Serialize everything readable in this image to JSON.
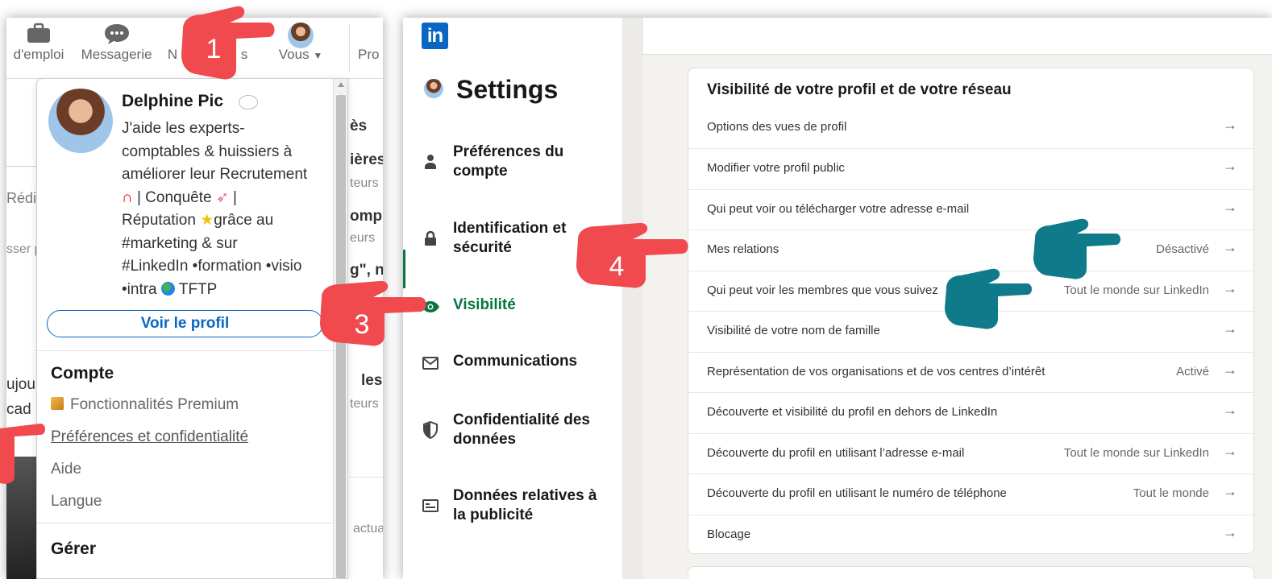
{
  "left_panel": {
    "nav": [
      {
        "label": "d'emploi",
        "icon": "briefcase-icon"
      },
      {
        "label": "Messagerie",
        "icon": "message-icon"
      },
      {
        "label": "N",
        "icon": "bell-icon"
      },
      {
        "label": "s",
        "icon": ""
      },
      {
        "label": "Vous",
        "icon": "avatar-icon"
      },
      {
        "label": "Pro",
        "icon": ""
      }
    ],
    "bg_fragments": [
      "ès",
      "ières",
      "teurs",
      "ompl",
      "eurs",
      "g\", no",
      "les p",
      "teurs",
      "actua",
      "Rédig",
      "sser p",
      "ujou",
      "cad"
    ],
    "dropdown": {
      "name": "Delphine Pic",
      "headline_lines": [
        "J'aide les experts-",
        "comptables & huissiers à",
        "améliorer leur Recrutement",
        "| Conquête",
        "|",
        "Réputation",
        "grâce au",
        "#marketing & sur",
        "#LinkedIn •formation •visio",
        "•intra",
        "TFTP"
      ],
      "view_profile": "Voir le profil",
      "account_title": "Compte",
      "account_items": [
        "Fonctionnalités Premium",
        "Préférences et confidentialité",
        "Aide",
        "Langue"
      ],
      "manage_title": "Gérer"
    }
  },
  "right_panel": {
    "logo": "in",
    "settings_title": "Settings",
    "sidebar": [
      {
        "label": "Préférences du compte",
        "icon": "person-icon",
        "active": false
      },
      {
        "label": "Identification et sécurité",
        "icon": "lock-icon",
        "active": false
      },
      {
        "label": "Visibilité",
        "icon": "eye-icon",
        "active": true
      },
      {
        "label": "Communications",
        "icon": "envelope-icon",
        "active": false
      },
      {
        "label": "Confidentialité des données",
        "icon": "shield-icon",
        "active": false
      },
      {
        "label": "Données relatives à la publicité",
        "icon": "ad-icon",
        "active": false
      }
    ],
    "card_title": "Visibilité de votre profil et de votre réseau",
    "rows": [
      {
        "label": "Options des vues de profil",
        "value": ""
      },
      {
        "label": "Modifier votre profil public",
        "value": ""
      },
      {
        "label": "Qui peut voir ou télécharger votre adresse e-mail",
        "value": ""
      },
      {
        "label": "Mes relations",
        "value": "Désactivé"
      },
      {
        "label": "Qui peut voir les membres que vous suivez",
        "value": "Tout le monde sur LinkedIn"
      },
      {
        "label": "Visibilité de votre nom de famille",
        "value": ""
      },
      {
        "label": "Représentation de vos organisations et de vos centres d’intérêt",
        "value": "Activé"
      },
      {
        "label": "Découverte et visibilité du profil en dehors de LinkedIn",
        "value": ""
      },
      {
        "label": "Découverte du profil en utilisant l’adresse e-mail",
        "value": "Tout le monde sur LinkedIn"
      },
      {
        "label": "Découverte du profil en utilisant le numéro de téléphone",
        "value": "Tout le monde"
      },
      {
        "label": "Blocage",
        "value": ""
      }
    ],
    "arrow": "→"
  },
  "annotations": {
    "steps": [
      "1",
      "3",
      "4"
    ],
    "colors": {
      "red": "#f04a4f",
      "teal": "#0e7a8a",
      "linkedin_blue": "#0a66c2",
      "active_green": "#057642"
    }
  }
}
